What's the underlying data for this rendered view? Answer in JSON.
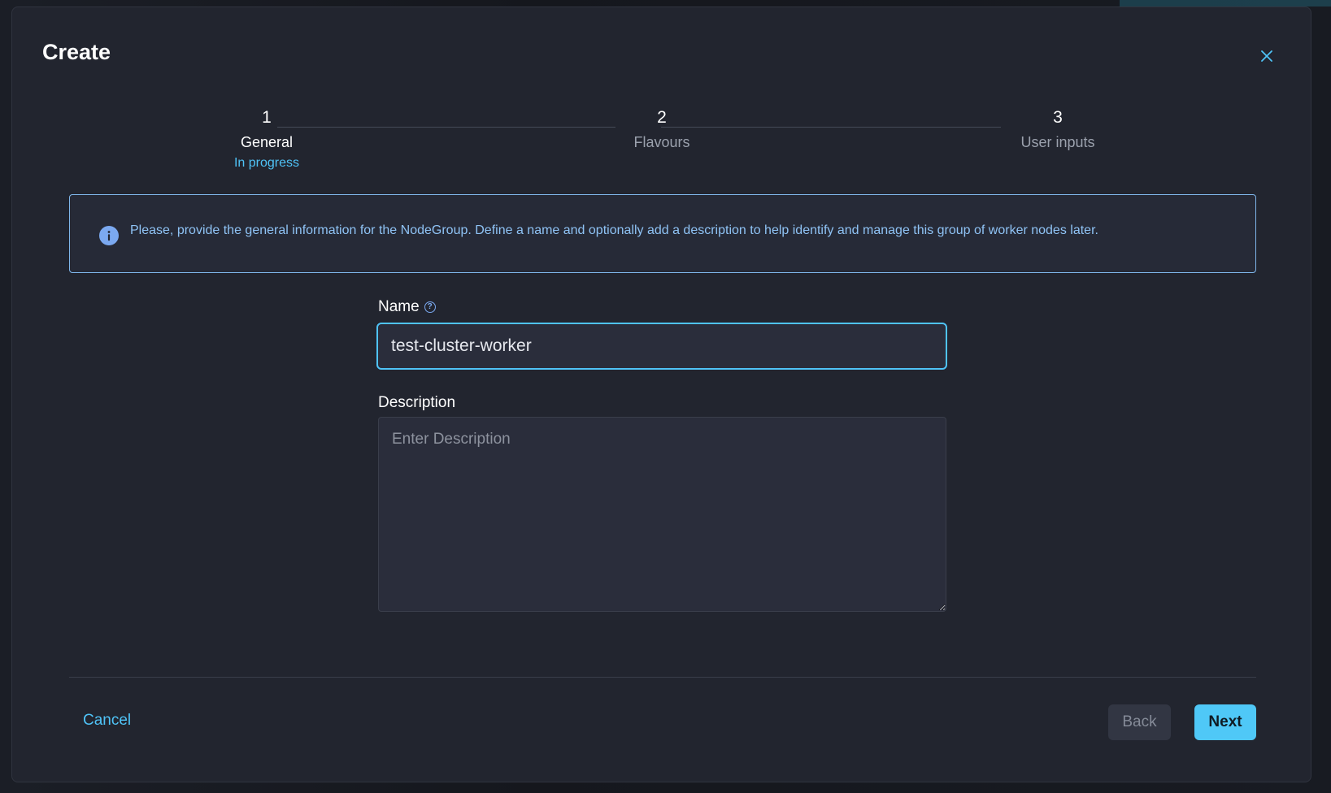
{
  "dialog": {
    "title": "Create",
    "close_icon": "close-icon"
  },
  "stepper": {
    "steps": [
      {
        "number": "1",
        "label": "General",
        "status": "In progress",
        "state": "active"
      },
      {
        "number": "2",
        "label": "Flavours",
        "status": "",
        "state": "inactive"
      },
      {
        "number": "3",
        "label": "User inputs",
        "status": "",
        "state": "inactive"
      }
    ]
  },
  "info": {
    "icon": "info-icon",
    "text": "Please, provide the general information for the NodeGroup. Define a name and optionally add a description to help identify and manage this group of worker nodes later."
  },
  "form": {
    "name_label": "Name",
    "name_help_icon": "help-circle-icon",
    "name_value": "test-cluster-worker",
    "description_label": "Description",
    "description_placeholder": "Enter Description",
    "description_value": ""
  },
  "footer": {
    "cancel_label": "Cancel",
    "back_label": "Back",
    "next_label": "Next"
  },
  "colors": {
    "accent": "#4fc3f7",
    "info_border": "#7fb6ea",
    "modal_bg": "#22252f"
  }
}
